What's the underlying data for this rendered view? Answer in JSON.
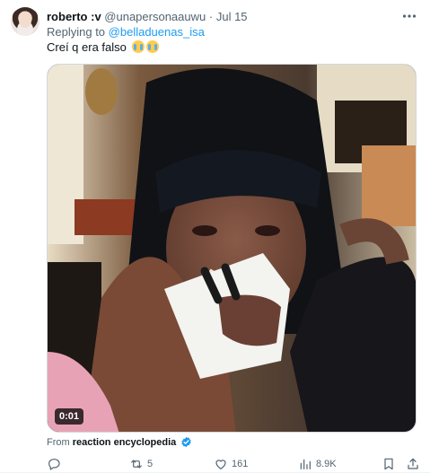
{
  "tweet": {
    "display_name": "roberto :v",
    "handle": "@unapersonaauwu",
    "separator": "·",
    "date": "Jul 15",
    "reply_prefix": "Replying to ",
    "reply_to": "@belladuenas_isa",
    "text": "Creí q era falso",
    "emoji_icon": "loudly-crying-face-icon",
    "media": {
      "duration": "0:01"
    },
    "attribution": {
      "prefix": "From ",
      "source": "reaction encyclopedia",
      "verified_color": "#1d9bf0"
    },
    "actions": {
      "reply_count": "",
      "retweet_count": "5",
      "like_count": "161",
      "view_count": "8.9K"
    }
  },
  "colors": {
    "accent": "#1d9bf0",
    "secondary_text": "#536471",
    "primary_text": "#0f1419"
  }
}
